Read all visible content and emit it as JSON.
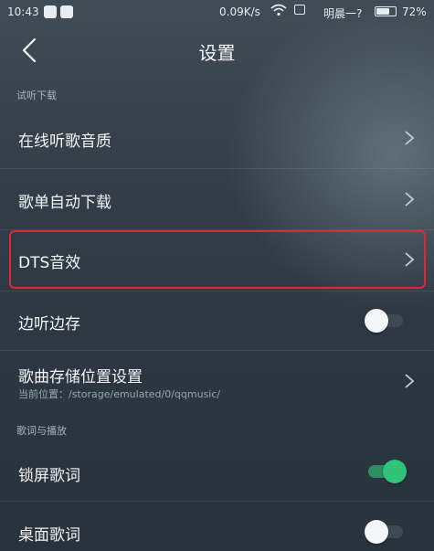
{
  "status_bar": {
    "time": "10:43",
    "network_speed": "0.09K/s",
    "carrier": "明晨一?",
    "battery": "72%",
    "battery_level": 0.72
  },
  "header": {
    "title": "设置"
  },
  "sections": {
    "download": {
      "title": "试听下载"
    },
    "lyrics": {
      "title": "歌词与播放"
    }
  },
  "items": {
    "online_quality": {
      "label": "在线听歌音质"
    },
    "auto_download": {
      "label": "歌单自动下载"
    },
    "dts": {
      "label": "DTS音效"
    },
    "cache_while_play": {
      "label": "边听边存",
      "enabled": false
    },
    "storage_location": {
      "label": "歌曲存储位置设置",
      "subtitle": "当前位置：/storage/emulated/0/qqmusic/"
    },
    "lockscreen_lyrics": {
      "label": "锁屏歌词",
      "enabled": true
    },
    "desktop_lyrics": {
      "label": "桌面歌词",
      "enabled": false
    }
  },
  "colors": {
    "toggle_on": "#30c27a",
    "highlight_box": "#e2253c"
  }
}
